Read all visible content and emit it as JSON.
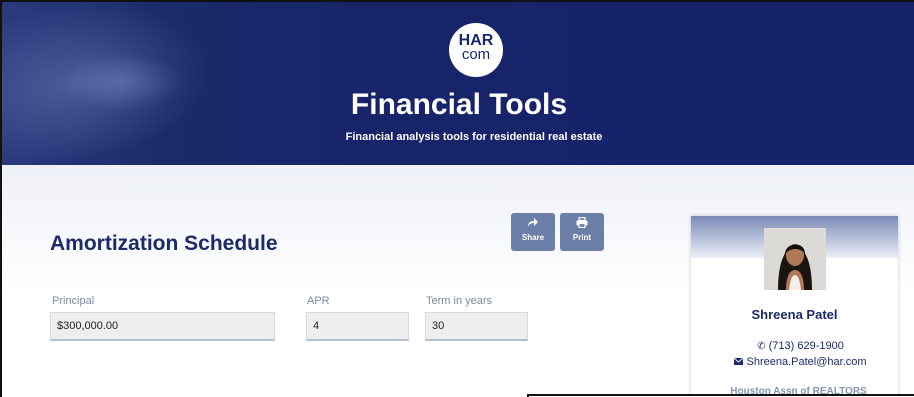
{
  "header": {
    "logo_top": "HAR",
    "logo_bottom": "com",
    "title": "Financial Tools",
    "subtitle": "Financial analysis tools for residential real estate"
  },
  "main": {
    "title": "Amortization Schedule",
    "share_label": "Share",
    "print_label": "Print",
    "fields": {
      "principal": {
        "label": "Principal",
        "value": "$300,000.00"
      },
      "apr": {
        "label": "APR",
        "value": "4"
      },
      "term": {
        "label": "Term in years",
        "value": "30"
      }
    }
  },
  "agent": {
    "name": "Shreena Patel",
    "phone": "(713) 629-1900",
    "email": "Shreena.Patel@har.com",
    "org": "Houston Assn of REALTORS"
  },
  "colors": {
    "brand_navy": "#1b2a6a",
    "button_blue": "#6c7fa8",
    "label_gray": "#7c8aa5"
  },
  "icons": {
    "share": "share-icon",
    "print": "print-icon",
    "phone": "phone-icon",
    "email": "envelope-icon"
  }
}
